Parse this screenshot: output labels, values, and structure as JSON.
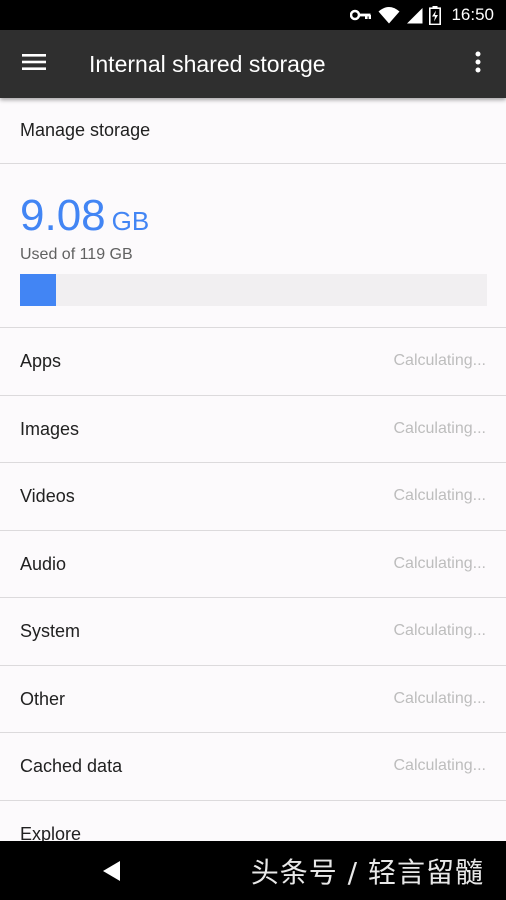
{
  "status_bar": {
    "time": "16:50",
    "icons": [
      "vpn-key-icon",
      "wifi-icon",
      "cell-signal-icon",
      "battery-icon"
    ]
  },
  "app_bar": {
    "title": "Internal shared storage",
    "icons": [
      "menu-icon",
      "overflow-menu-icon"
    ]
  },
  "manage_storage_label": "Manage storage",
  "storage": {
    "used_value": "9.08",
    "used_unit": "GB",
    "caption": "Used of 119 GB",
    "used_fraction": 0.0763,
    "accent_color": "#4285f4"
  },
  "categories": [
    {
      "label": "Apps",
      "status": "Calculating..."
    },
    {
      "label": "Images",
      "status": "Calculating..."
    },
    {
      "label": "Videos",
      "status": "Calculating..."
    },
    {
      "label": "Audio",
      "status": "Calculating..."
    },
    {
      "label": "System",
      "status": "Calculating..."
    },
    {
      "label": "Other",
      "status": "Calculating..."
    },
    {
      "label": "Cached data",
      "status": "Calculating..."
    },
    {
      "label": "Explore",
      "status": ""
    }
  ],
  "nav_bar": {
    "icons": [
      "back-icon"
    ],
    "watermark": "头条号 / 轻言留髓"
  }
}
